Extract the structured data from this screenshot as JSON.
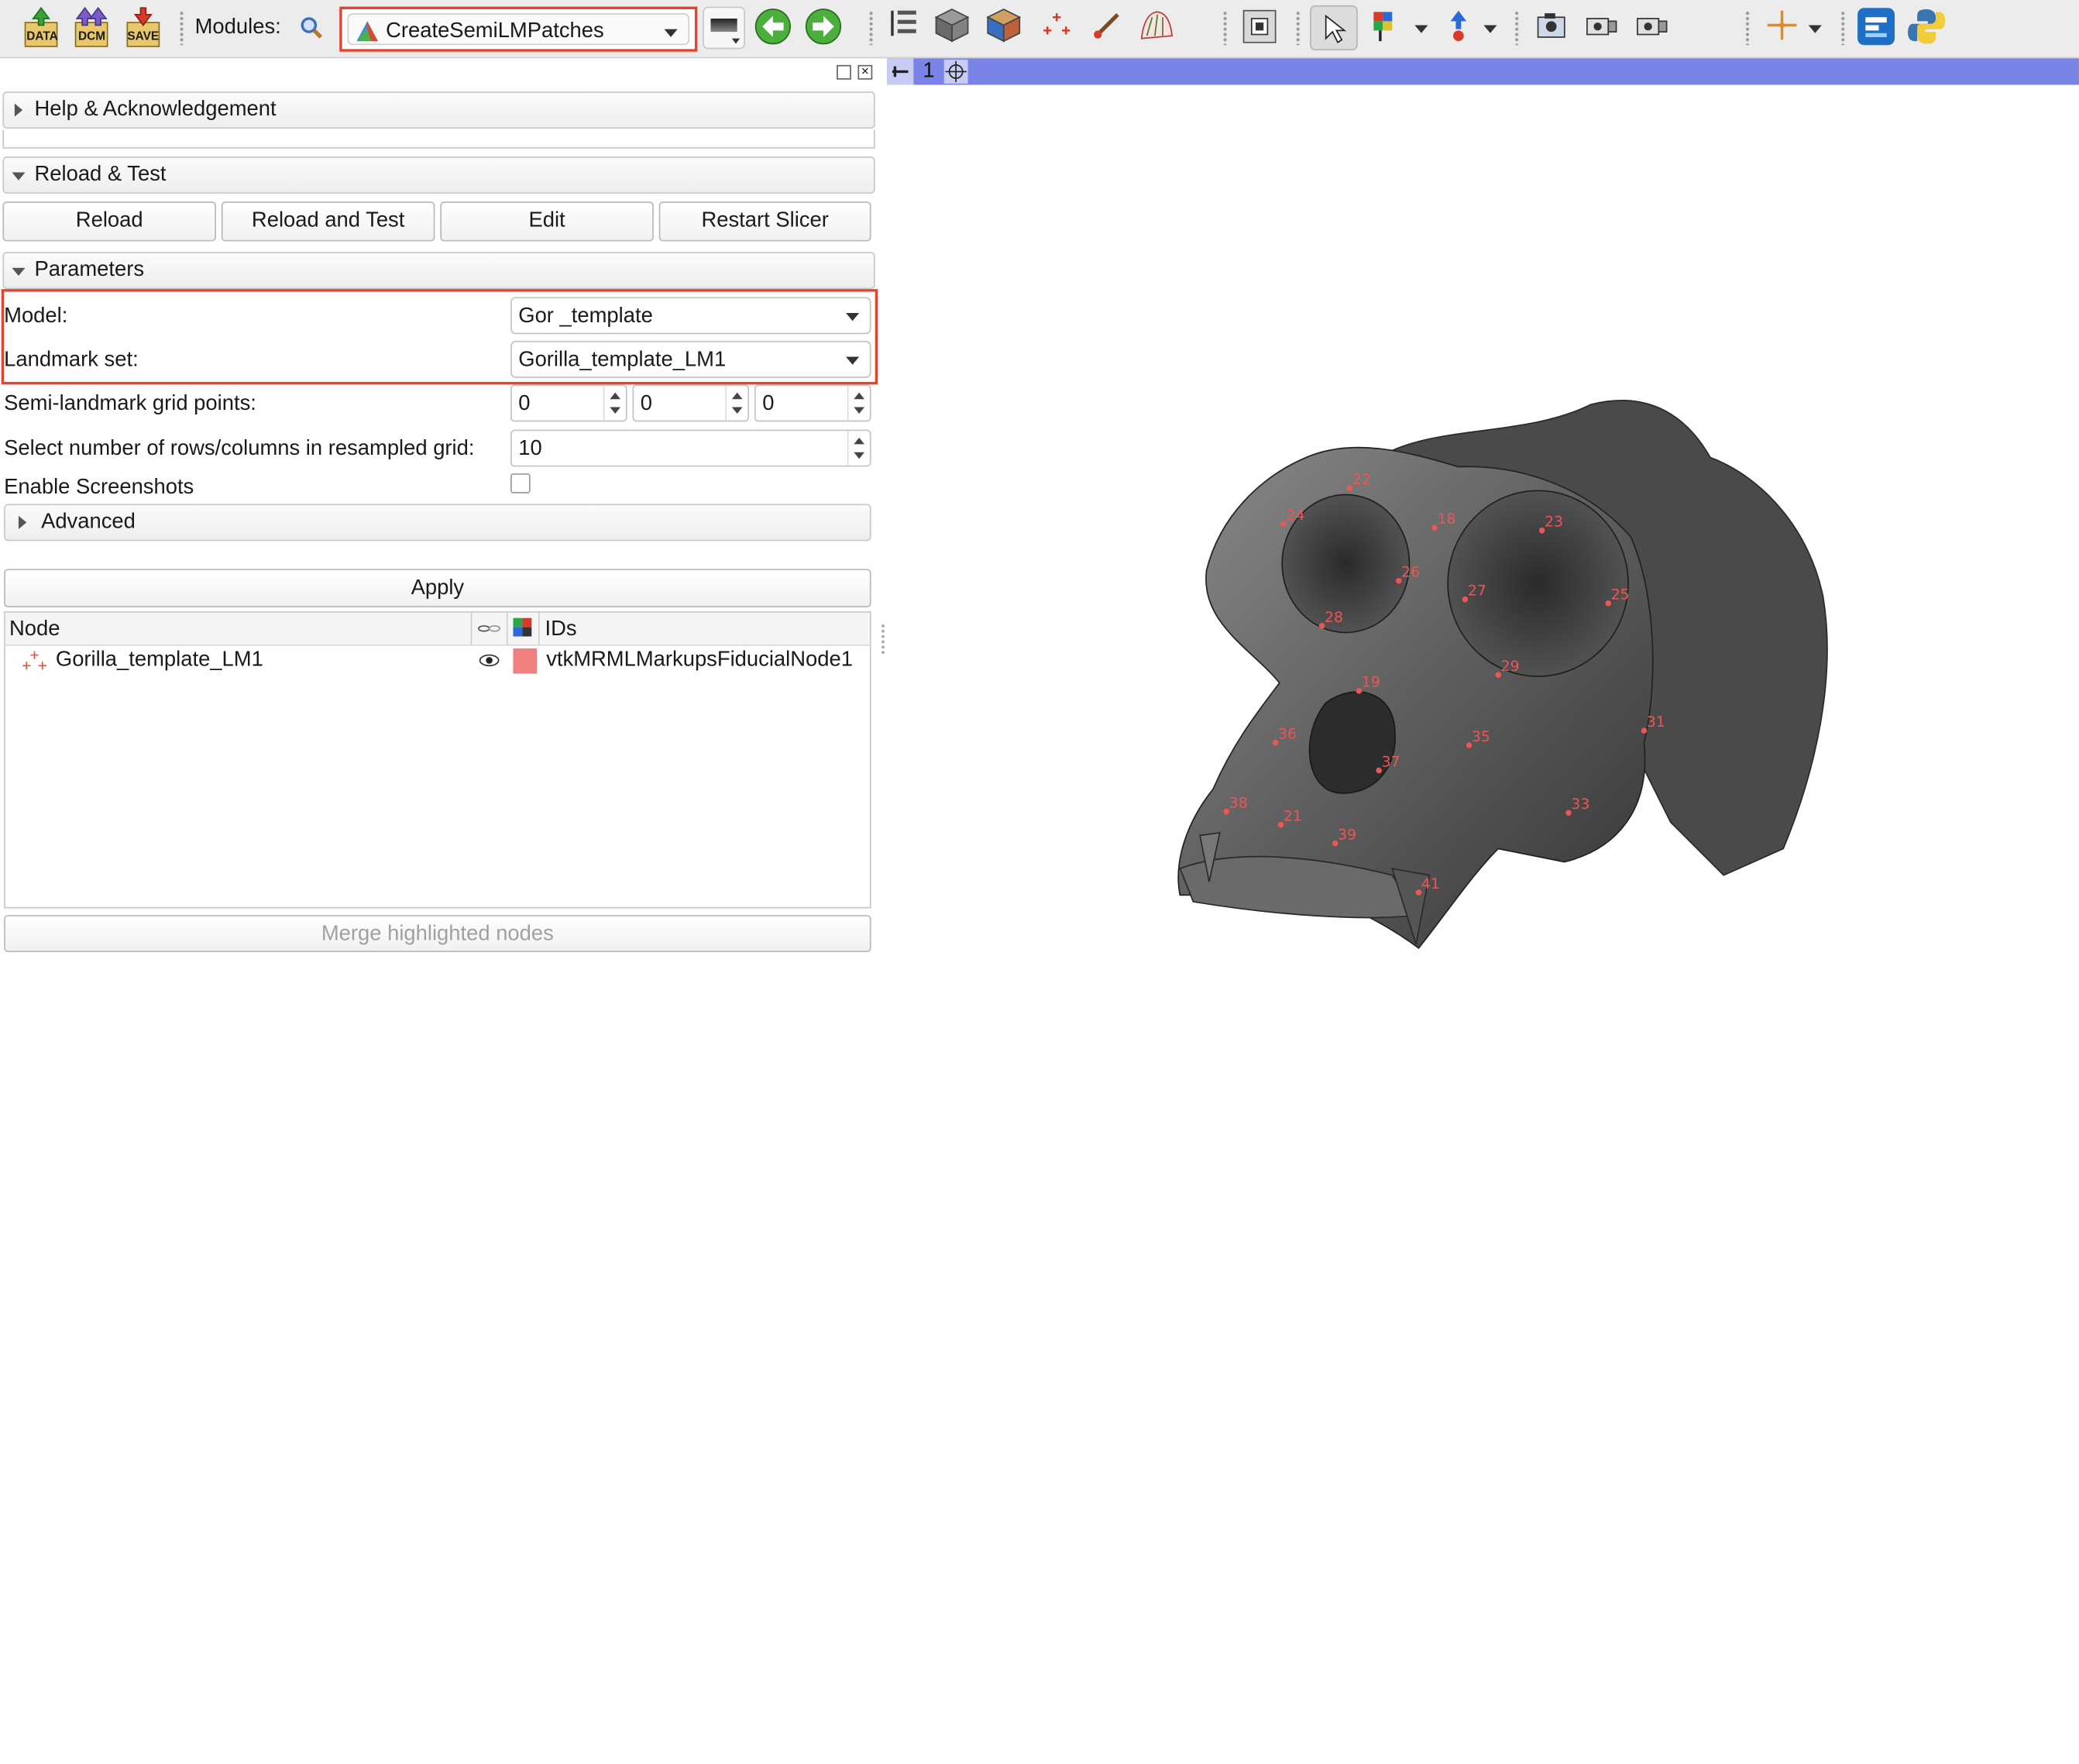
{
  "toolbar": {
    "data_label": "DATA",
    "dcm_label": "DCM",
    "save_label": "SAVE",
    "modules_label": "Modules:",
    "selected_module": "CreateSemiLMPatches"
  },
  "view": {
    "layout_number": "1"
  },
  "panel": {
    "help_section": "Help & Acknowledgement",
    "reload_section": "Reload & Test",
    "buttons": {
      "reload": "Reload",
      "reload_and_test": "Reload and Test",
      "edit": "Edit",
      "restart": "Restart Slicer"
    },
    "parameters_section": "Parameters",
    "model_label": "Model:",
    "model_value": "Gor _template",
    "landmark_label": "Landmark set:",
    "landmark_value": "Gorilla_template_LM1",
    "grid_points_label": "Semi-landmark grid points:",
    "grid_points": [
      "0",
      "0",
      "0"
    ],
    "rows_cols_label": "Select number of rows/columns in resampled grid:",
    "rows_cols_value": "10",
    "screenshots_label": "Enable Screenshots",
    "screenshots_enabled": false,
    "advanced_section": "Advanced",
    "apply_button": "Apply",
    "table": {
      "headers": {
        "node": "Node",
        "ids": "IDs"
      },
      "rows": [
        {
          "node": "Gorilla_template_LM1",
          "color": "#f08080",
          "id": "vtkMRMLMarkupsFiducialNode1"
        }
      ]
    },
    "merge_button": "Merge highlighted nodes"
  },
  "landmarks": [
    "22",
    "24",
    "18",
    "23",
    "26",
    "27",
    "25",
    "28",
    "29",
    "19",
    "31",
    "36",
    "35",
    "37",
    "33",
    "38",
    "21",
    "39",
    "41"
  ],
  "colors": {
    "highlight": "#e2452f",
    "view_bar": "#7a84e6",
    "landmark": "#ee5555"
  }
}
